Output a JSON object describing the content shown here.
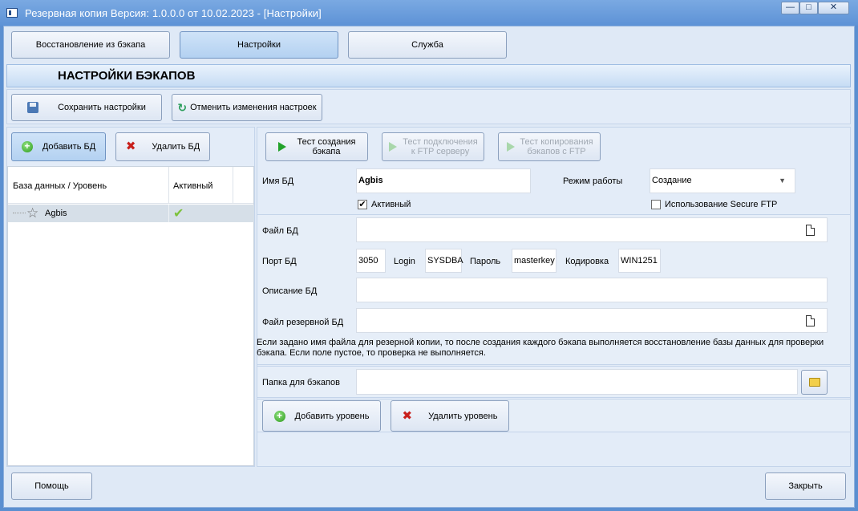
{
  "window": {
    "title": "Резервная копия   Версия: 1.0.0.0 от 10.02.2023 - [Настройки]",
    "min_glyph": "—",
    "max_glyph": "□",
    "close_glyph": "✕"
  },
  "tabs": [
    {
      "label": "Восстановление из бэкапа"
    },
    {
      "label": "Настройки"
    },
    {
      "label": "Служба"
    }
  ],
  "section_title": "НАСТРОЙКИ БЭКАПОВ",
  "toolbar": {
    "save_label": "Сохранить настройки",
    "revert_label": "Отменить изменения настроек"
  },
  "db_buttons": {
    "add_label": "Добавить БД",
    "delete_label": "Удалить БД"
  },
  "db_table": {
    "columns": [
      "База данных / Уровень",
      "Активный"
    ],
    "rows": [
      {
        "name": "Agbis",
        "active_mark": "✔"
      }
    ]
  },
  "test_buttons": {
    "create_label": "Тест создания бэкапа",
    "ftp_connect_label": "Тест подключения к FTP серверу",
    "ftp_copy_label": "Тест копирования бэкапов с FTP"
  },
  "form": {
    "db_name_label": "Имя БД",
    "db_name_value": "Agbis",
    "mode_label": "Режим работы",
    "mode_value": "Создание",
    "active_label": "Активный",
    "active_checked": "✔",
    "secure_ftp_label": "Использование Secure FTP",
    "db_file_label": "Файл БД",
    "db_file_value": "",
    "port_label": "Порт БД",
    "port_value": "3050",
    "login_label": "Login",
    "login_value": "SYSDBA",
    "password_label": "Пароль",
    "password_value": "masterkey",
    "encoding_label": "Кодировка",
    "encoding_value": "WIN1251",
    "description_label": "Описание БД",
    "description_value": "",
    "backup_file_label": "Файл резервной БД",
    "backup_file_value": "",
    "hint_line1": "Если задано имя файла для резерной копии, то после создания каждого бэкапа выполняется восстановление базы данных для проверки",
    "hint_line2": "бэкапа. Если поле пустое, то проверка не выполняется.",
    "folder_label": "Папка для бэкапов",
    "folder_value": ""
  },
  "level_buttons": {
    "add_label": "Добавить уровень",
    "delete_label": "Удалить уровень"
  },
  "footer": {
    "help_label": "Помощь",
    "close_label": "Закрыть"
  }
}
